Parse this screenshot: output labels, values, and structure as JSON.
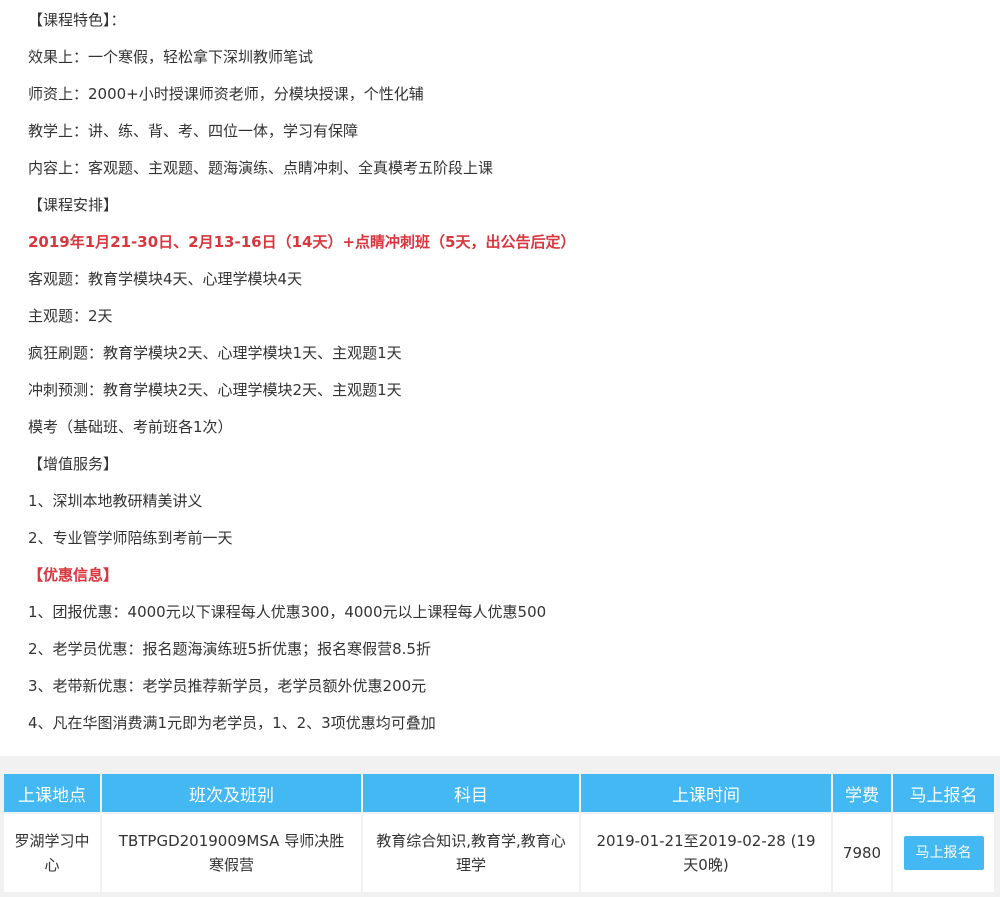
{
  "features": {
    "title": "【课程特色】：",
    "items": [
      "效果上：一个寒假，轻松拿下深圳教师笔试",
      "师资上：2000+小时授课师资老师，分模块授课，个性化辅",
      "教学上：讲、练、背、考、四位一体，学习有保障",
      "内容上：客观题、主观题、题海演练、点睛冲刺、全真模考五阶段上课"
    ]
  },
  "schedule": {
    "title": "【课程安排】",
    "highlight": "2019年1月21-30日、2月13-16日（14天）+点睛冲刺班（5天，出公告后定）",
    "items": [
      "客观题：教育学模块4天、心理学模块4天",
      "主观题：2天",
      "疯狂刷题：教育学模块2天、心理学模块1天、主观题1天",
      "冲刺预测：教育学模块2天、心理学模块2天、主观题1天",
      "模考（基础班、考前班各1次）"
    ]
  },
  "services": {
    "title": "【增值服务】",
    "items": [
      "1、深圳本地教研精美讲义",
      "2、专业管学师陪练到考前一天"
    ]
  },
  "discounts": {
    "title": "【优惠信息】",
    "items": [
      "1、团报优惠：4000元以下课程每人优惠300，4000元以上课程每人优惠500",
      "2、老学员优惠：报名题海演练班5折优惠；报名寒假营8.5折",
      "3、老带新优惠：老学员推荐新学员，老学员额外优惠200元",
      "4、凡在华图消费满1元即为老学员，1、2、3项优惠均可叠加"
    ]
  },
  "table": {
    "headers": [
      "上课地点",
      "班次及班别",
      "科目",
      "上课时间",
      "学费",
      "马上报名"
    ],
    "row": {
      "location": "罗湖学习中心",
      "class_name": "TBTPGD2019009MSA 导师决胜寒假营",
      "subject": "教育综合知识,教育学,教育心理学",
      "time": "2019-01-21至2019-02-28 (19天0晚)",
      "fee": "7980",
      "button": "马上报名"
    }
  },
  "colors": {
    "accent": "#43b8f2",
    "highlight_red": "#d9363e"
  }
}
